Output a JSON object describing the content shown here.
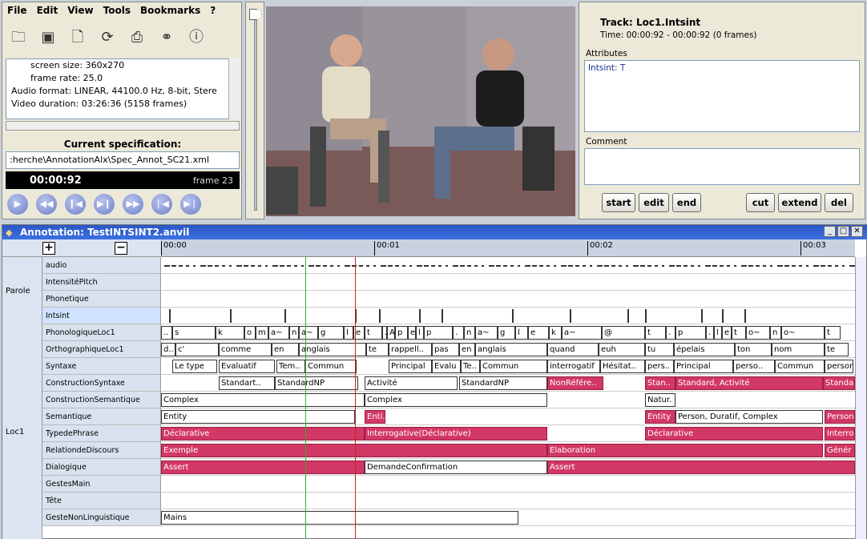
{
  "menu": [
    "File",
    "Edit",
    "View",
    "Tools",
    "Bookmarks",
    "?"
  ],
  "toolbar_icons": [
    "open-folder-icon",
    "save-icon",
    "new-file-icon",
    "reload-icon",
    "print-icon",
    "binoculars-icon",
    "info-icon"
  ],
  "info": {
    "lines": [
      "screen size: 360x270",
      "frame rate: 25.0",
      "Audio format: LINEAR, 44100.0 Hz, 8-bit, Stere",
      "Video duration: 03:26:36 (5158 frames)"
    ]
  },
  "spec": {
    "title": "Current specification:",
    "path": ":herche\\AnnotationAlx\\Spec_Annot_SC21.xml"
  },
  "time": {
    "code": "00:00:92",
    "frame": "frame 23"
  },
  "track": {
    "name": "Track: Loc1.Intsint",
    "time": "Time: 00:00:92 - 00:00:92 (0 frames)",
    "attributes_label": "Attributes",
    "attribute": "Intsint: T",
    "comment_label": "Comment"
  },
  "buttons": {
    "start": "start",
    "edit": "edit",
    "end": "end",
    "cut": "cut",
    "extend": "extend",
    "del": "del"
  },
  "annotation": {
    "title": "Annotation: TestINTSINT2.anvil",
    "ruler": [
      "00:00",
      "00:01",
      "00:02",
      "00:03"
    ],
    "groups": {
      "parole": "Parole",
      "loc1": "Loc1"
    },
    "rows": [
      "audio",
      "IntensitéPitch",
      "Phonetique",
      "Intsint",
      "PhonologiqueLoc1",
      "OrthographiqueLoc1",
      "Syntaxe",
      "ConstructionSyntaxe",
      "ConstructionSemantique",
      "Semantique",
      "TypedePhrase",
      "RelationdeDiscours",
      "Dialogique",
      "GestesMain",
      "Tête",
      "GesteNonLinguistique"
    ],
    "phono": [
      "..",
      "s",
      "k",
      "o",
      "m",
      "a~",
      "n",
      "a~",
      "g",
      "l",
      "e",
      "t",
      ".",
      "A",
      "p",
      "e",
      "l",
      "p",
      ".",
      "n",
      "a~",
      "g",
      "l",
      "e",
      "k",
      "a~",
      "@",
      "t",
      ".",
      "p",
      ".",
      "l",
      "e",
      "t",
      "o~",
      "n",
      "o~",
      "t"
    ],
    "ortho": [
      "d..",
      "c'",
      "comme",
      "en",
      "anglais",
      "te",
      "rappell..",
      "pas",
      "en",
      "anglais",
      "quand",
      "euh",
      "tu",
      "épelais",
      "ton",
      "nom",
      "te"
    ],
    "syntaxe": [
      "Le type",
      "Evaluatif",
      "Tem..",
      "Commun",
      "Principal",
      "Evalu",
      "Te..",
      "Commun",
      "interrogatif",
      "Hésitat..",
      "pers..",
      "Principal",
      "perso..",
      "Commun",
      "persor"
    ],
    "constr_synt": [
      "Standart..",
      "StandardNP",
      "Activité",
      "StandardNP",
      "NonRéfére..",
      "Stan..",
      "Standard, Activité",
      "Standa"
    ],
    "constr_sem": [
      "Complex",
      "Complex",
      "Natur."
    ],
    "semantique": [
      "Entity",
      "Enti..",
      "Entity",
      "Person, Duratif, Complex",
      "Person"
    ],
    "typephrase": [
      "Déclarative",
      "Interrogative(Déclarative)",
      "Déclarative",
      "Interro"
    ],
    "relation": [
      "Exemple",
      "Elaboration",
      "Génér"
    ],
    "dialogique": [
      "Assert",
      "DemandeConfirmation",
      "Assert"
    ],
    "geste": [
      "Mains"
    ]
  }
}
